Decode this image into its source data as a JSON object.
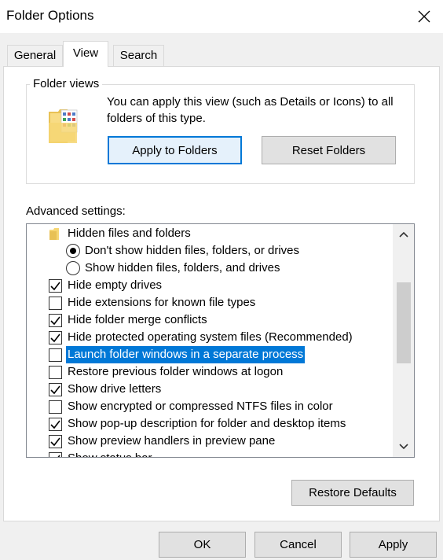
{
  "window": {
    "title": "Folder Options"
  },
  "tabs": [
    {
      "label": "General"
    },
    {
      "label": "View"
    },
    {
      "label": "Search"
    }
  ],
  "folder_views": {
    "legend": "Folder views",
    "description": "You can apply this view (such as Details or Icons) to all folders of this type.",
    "apply_label": "Apply to Folders",
    "reset_label": "Reset Folders"
  },
  "advanced": {
    "label": "Advanced settings:",
    "items": [
      {
        "type": "folder",
        "label": "Hidden files and folders"
      },
      {
        "type": "radio",
        "checked": true,
        "label": "Don't show hidden files, folders, or drives"
      },
      {
        "type": "radio",
        "checked": false,
        "label": "Show hidden files, folders, and drives"
      },
      {
        "type": "checkbox",
        "checked": true,
        "label": "Hide empty drives"
      },
      {
        "type": "checkbox",
        "checked": false,
        "label": "Hide extensions for known file types"
      },
      {
        "type": "checkbox",
        "checked": true,
        "label": "Hide folder merge conflicts"
      },
      {
        "type": "checkbox",
        "checked": true,
        "label": "Hide protected operating system files (Recommended)"
      },
      {
        "type": "checkbox",
        "checked": false,
        "selected": true,
        "label": "Launch folder windows in a separate process"
      },
      {
        "type": "checkbox",
        "checked": false,
        "label": "Restore previous folder windows at logon"
      },
      {
        "type": "checkbox",
        "checked": true,
        "label": "Show drive letters"
      },
      {
        "type": "checkbox",
        "checked": false,
        "label": "Show encrypted or compressed NTFS files in color"
      },
      {
        "type": "checkbox",
        "checked": true,
        "label": "Show pop-up description for folder and desktop items"
      },
      {
        "type": "checkbox",
        "checked": true,
        "label": "Show preview handlers in preview pane"
      },
      {
        "type": "checkbox",
        "checked": true,
        "label": "Show status bar"
      }
    ]
  },
  "buttons": {
    "restore_defaults": "Restore Defaults",
    "ok": "OK",
    "cancel": "Cancel",
    "apply": "Apply"
  },
  "colors": {
    "selection": "#0078d7",
    "focus_border": "#0078d7",
    "button_face": "#e1e1e1"
  },
  "icons": {
    "close": "close-icon",
    "folder": "folder-icon",
    "scroll_up": "chevron-up-icon",
    "scroll_down": "chevron-down-icon"
  }
}
